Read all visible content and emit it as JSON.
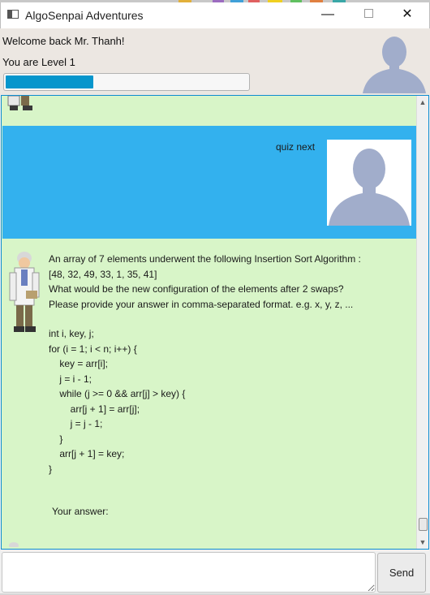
{
  "window": {
    "title": "AlgoSenpai Adventures",
    "minimize_glyph": "—",
    "close_glyph": "✕"
  },
  "header": {
    "welcome_text": "Welcome back Mr. Thanh!",
    "level_text": "You are Level 1",
    "progress_fraction": 0.36,
    "progress_color": "#0696cc"
  },
  "chat": {
    "user_message": "quiz next",
    "bot_question_lines": [
      "An array of 7 elements underwent the following Insertion Sort Algorithm :",
      "[48, 32, 49, 33, 1, 35, 41]",
      "What would be the new configuration of the elements after 2 swaps?",
      "Please provide your answer in comma-separated format. e.g. x, y, z, ..."
    ],
    "code_lines": [
      "int i, key, j;",
      "for (i = 1; i < n; i++) {",
      "    key = arr[i];",
      "    j = i - 1;",
      "    while (j >= 0 && arr[j] > key) {",
      "        arr[j + 1] = arr[j];",
      "        j = j - 1;",
      "    }",
      "    arr[j + 1] = key;",
      "}"
    ],
    "answer_prompt": "Your answer:"
  },
  "input": {
    "value": "",
    "send_label": "Send"
  },
  "colors": {
    "chat_background": "#d8f5c8",
    "user_bubble": "#33b1ee",
    "avatar_silhouette": "#a1adcb"
  },
  "icons": {
    "scroll_up": "▲",
    "scroll_down": "▼"
  }
}
